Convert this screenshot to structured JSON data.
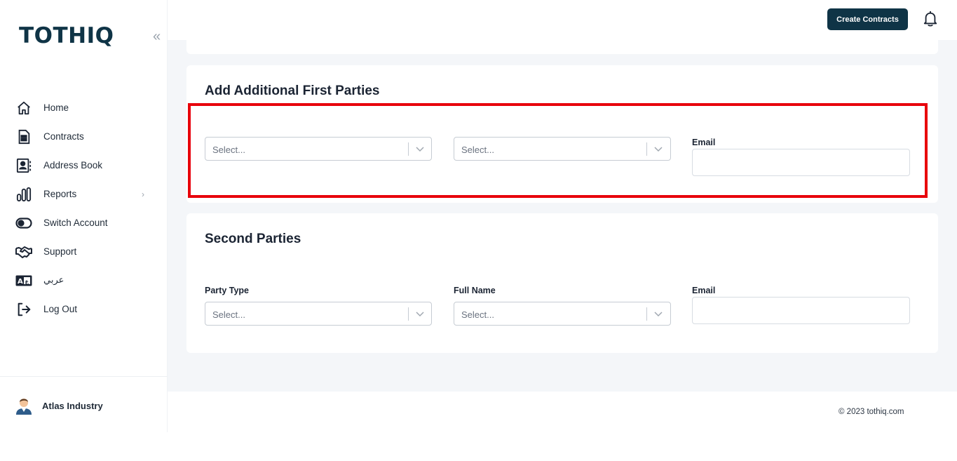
{
  "brand": {
    "logo_text": "TOTHIQ",
    "primary_color": "#0f3446",
    "highlight_color": "#e8000b"
  },
  "sidebar": {
    "collapse_icon": "chevrons-left-icon",
    "items": [
      {
        "label": "Home",
        "icon": "home-icon"
      },
      {
        "label": "Contracts",
        "icon": "document-icon"
      },
      {
        "label": "Address Book",
        "icon": "address-book-icon"
      },
      {
        "label": "Reports",
        "icon": "bar-chart-icon",
        "has_submenu": true
      },
      {
        "label": "Switch Account",
        "icon": "toggle-icon"
      },
      {
        "label": "Support",
        "icon": "handshake-icon"
      },
      {
        "label": "عربي",
        "icon": "translate-icon"
      },
      {
        "label": "Log Out",
        "icon": "logout-icon"
      }
    ],
    "user": {
      "name": "Atlas Industry",
      "icon": "user-avatar-icon"
    }
  },
  "header": {
    "create_button": "Create Contracts",
    "bell_icon": "bell-icon"
  },
  "first_parties": {
    "title": "Add Additional First Parties",
    "party_type": {
      "placeholder": "Select..."
    },
    "full_name": {
      "placeholder": "Select..."
    },
    "email": {
      "label": "Email",
      "value": ""
    }
  },
  "second_parties": {
    "title": "Second Parties",
    "party_type": {
      "label": "Party Type",
      "placeholder": "Select..."
    },
    "full_name": {
      "label": "Full Name",
      "placeholder": "Select..."
    },
    "email": {
      "label": "Email",
      "value": ""
    }
  },
  "footer": {
    "copyright": "© 2023 tothiq.com"
  }
}
